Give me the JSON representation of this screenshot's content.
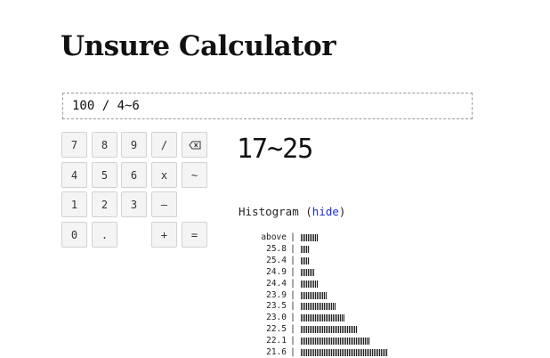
{
  "title": "Unsure Calculator",
  "input": {
    "value": "100 / 4~6"
  },
  "keypad": [
    {
      "label": "7",
      "name": "key-7"
    },
    {
      "label": "8",
      "name": "key-8"
    },
    {
      "label": "9",
      "name": "key-9"
    },
    {
      "label": "/",
      "name": "key-divide"
    },
    {
      "label": "",
      "name": "backspace-key",
      "icon": "backspace-icon"
    },
    {
      "label": "4",
      "name": "key-4"
    },
    {
      "label": "5",
      "name": "key-5"
    },
    {
      "label": "6",
      "name": "key-6"
    },
    {
      "label": "x",
      "name": "key-multiply"
    },
    {
      "label": "~",
      "name": "key-tilde"
    },
    {
      "label": "1",
      "name": "key-1"
    },
    {
      "label": "2",
      "name": "key-2"
    },
    {
      "label": "3",
      "name": "key-3"
    },
    {
      "label": "–",
      "name": "key-minus"
    },
    {
      "label": "0",
      "name": "key-0"
    },
    {
      "label": ".",
      "name": "key-decimal"
    },
    {
      "label": "+",
      "name": "key-plus"
    },
    {
      "label": "=",
      "name": "key-equals"
    }
  ],
  "result": "17~25",
  "histogram": {
    "heading": "Histogram",
    "open_paren": "(",
    "toggle_label": "hide",
    "close_paren": ")",
    "separator": "|",
    "rows": [
      {
        "label": "above",
        "value": 0.2
      },
      {
        "label": "25.8",
        "value": 0.1
      },
      {
        "label": "25.4",
        "value": 0.1
      },
      {
        "label": "24.9",
        "value": 0.15
      },
      {
        "label": "24.4",
        "value": 0.2
      },
      {
        "label": "23.9",
        "value": 0.3
      },
      {
        "label": "23.5",
        "value": 0.4
      },
      {
        "label": "23.0",
        "value": 0.5
      },
      {
        "label": "22.5",
        "value": 0.65
      },
      {
        "label": "22.1",
        "value": 0.8
      },
      {
        "label": "21.6",
        "value": 1.0
      }
    ]
  }
}
